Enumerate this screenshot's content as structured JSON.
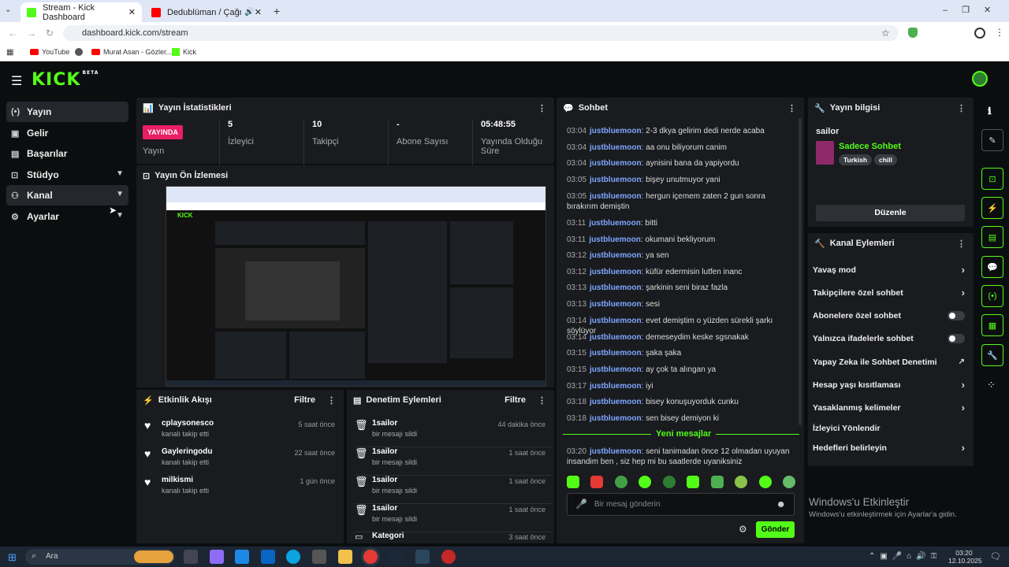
{
  "browser": {
    "tabs": [
      {
        "label": "Stream - Kick Dashboard"
      },
      {
        "label": "Dedublüman / Çağn Çelik -"
      }
    ],
    "url": "dashboard.kick.com/stream",
    "bookmarks": [
      {
        "label": "YouTube"
      },
      {
        "label": "Murat Asan - Gözler..."
      },
      {
        "label": "Kick"
      }
    ]
  },
  "app": {
    "logo": "KICK",
    "logo_badge": "BETA"
  },
  "sidebar": {
    "items": [
      {
        "label": "Yayın"
      },
      {
        "label": "Gelir"
      },
      {
        "label": "Başarılar"
      },
      {
        "label": "Stüdyo"
      },
      {
        "label": "Kanal"
      },
      {
        "label": "Ayarlar"
      }
    ]
  },
  "stats": {
    "title": "Yayın İstatistikleri",
    "live_badge": "YAYINDA",
    "live_label": "Yayın",
    "viewers": {
      "value": "5",
      "label": "İzleyici"
    },
    "followers": {
      "value": "10",
      "label": "Takipçi"
    },
    "subs": {
      "value": "-",
      "label": "Abone Sayısı"
    },
    "uptime": {
      "value": "05:48:55",
      "label": "Yayında Olduğu Süre"
    }
  },
  "preview": {
    "title": "Yayın Ön İzlemesi"
  },
  "activity": {
    "title": "Etkinlik Akışı",
    "filter": "Filtre",
    "rows": [
      {
        "name": "cplaysonesco",
        "sub": "kanalı takip etti",
        "time": "5 saat önce"
      },
      {
        "name": "Gaylerin­godu",
        "sub": "kanalı takip etti",
        "time": "22 saat önce"
      },
      {
        "name": "milkismi",
        "sub": "kanalı takip etti",
        "time": "1 gün önce"
      }
    ]
  },
  "moderation": {
    "title": "Denetim Eylemleri",
    "filter": "Filtre",
    "rows": [
      {
        "name": "1sailor",
        "sub": "bir mesajı sildi",
        "time": "44 dakika önce"
      },
      {
        "name": "1sailor",
        "sub": "bir mesajı sildi",
        "time": "1 saat önce"
      },
      {
        "name": "1sailor",
        "sub": "bir mesajı sildi",
        "time": "1 saat önce"
      },
      {
        "name": "1sailor",
        "sub": "bir mesajı sildi",
        "time": "1 saat önce"
      },
      {
        "name": "Kategori",
        "sub": "",
        "time": "3 saat önce"
      }
    ]
  },
  "chat": {
    "title": "Sohbet",
    "messages": [
      {
        "t": "03:04",
        "u": "justbluemoon",
        "m": ": 2-3 dkya gelirim dedi nerde acaba"
      },
      {
        "t": "03:04",
        "u": "justbluemoon",
        "m": ": aa onu biliyorum canim"
      },
      {
        "t": "03:04",
        "u": "justbluemoon",
        "m": ": aynisini bana da yapiyordu"
      },
      {
        "t": "03:05",
        "u": "justbluemoon",
        "m": ": bişey unutmuyor yani"
      },
      {
        "t": "03:05",
        "u": "justbluemoon",
        "m": ": hergun içemem zaten 2 gun sonra bırakırım demiştin"
      },
      {
        "t": "03:11",
        "u": "justbluemoon",
        "m": ": bitti"
      },
      {
        "t": "03:11",
        "u": "justbluemoon",
        "m": ": okumani bekliyorum"
      },
      {
        "t": "03:12",
        "u": "justbluemoon",
        "m": ": ya sen"
      },
      {
        "t": "03:12",
        "u": "justbluemoon",
        "m": ": küfür edermisin lutfen inanc"
      },
      {
        "t": "03:13",
        "u": "justbluemoon",
        "m": ": şarkinin seni biraz fazla"
      },
      {
        "t": "03:13",
        "u": "justbluemoon",
        "m": ": sesi"
      },
      {
        "t": "03:14",
        "u": "justbluemoon",
        "m": ": evet demiştim o yüzden sürekli şarkı söylüyor"
      },
      {
        "t": "03:14",
        "u": "justbluemoon",
        "m": ": demeseydim keske sgsnakak"
      },
      {
        "t": "03:15",
        "u": "justbluemoon",
        "m": ": şaka şaka"
      },
      {
        "t": "03:15",
        "u": "justbluemoon",
        "m": ": ay çok ta alıngan ya"
      },
      {
        "t": "03:17",
        "u": "justbluemoon",
        "m": ": iyi"
      },
      {
        "t": "03:18",
        "u": "justbluemoon",
        "m": ": bisey konuşuyorduk cunku"
      },
      {
        "t": "03:18",
        "u": "justbluemoon",
        "m": ": sen bisey demiyon ki"
      }
    ],
    "new_messages": "Yeni mesajlar",
    "new_msg": {
      "t": "03:20",
      "u": "justbluemoon",
      "m": ": seni tanimadan önce 12 olmadan uyuyan insandim ben , siz hep mi bu saatlerde uyaniksiniz"
    },
    "input_placeholder": "Bir mesaj gönderin",
    "send_label": "Gönder"
  },
  "stream_info": {
    "title": "Yayın bilgisi",
    "stream_title": "sailor",
    "category": "Sadece Sohbet",
    "tags": [
      "Turkish",
      "chill"
    ],
    "edit_label": "Düzenle"
  },
  "channel_actions": {
    "title": "Kanal Eylemleri",
    "items": [
      {
        "label": "Yavaş mod"
      },
      {
        "label": "Takipçilere özel sohbet"
      },
      {
        "label": "Abonelere özel sohbet"
      },
      {
        "label": "Yalnızca ifadelerle sohbet"
      },
      {
        "label": "Yapay Zeka ile Sohbet Denetimi"
      },
      {
        "label": "Hesap yaşı kısıtlaması"
      },
      {
        "label": "Yasaklanmış kelimeler"
      },
      {
        "label": "İzleyici Yönlendir"
      },
      {
        "label": "Hedefleri belirleyin"
      }
    ]
  },
  "windows": {
    "activation_title": "Windows'u Etkinleştir",
    "activation_sub": "Windows'u etkinleştirmek için Ayarlar'a gidin.",
    "search": "Ara",
    "time": "03:20",
    "date": "12.10.2025"
  },
  "colors": {
    "accent": "#53fc18",
    "live": "#e91e63",
    "username": "#7ea7ff"
  }
}
